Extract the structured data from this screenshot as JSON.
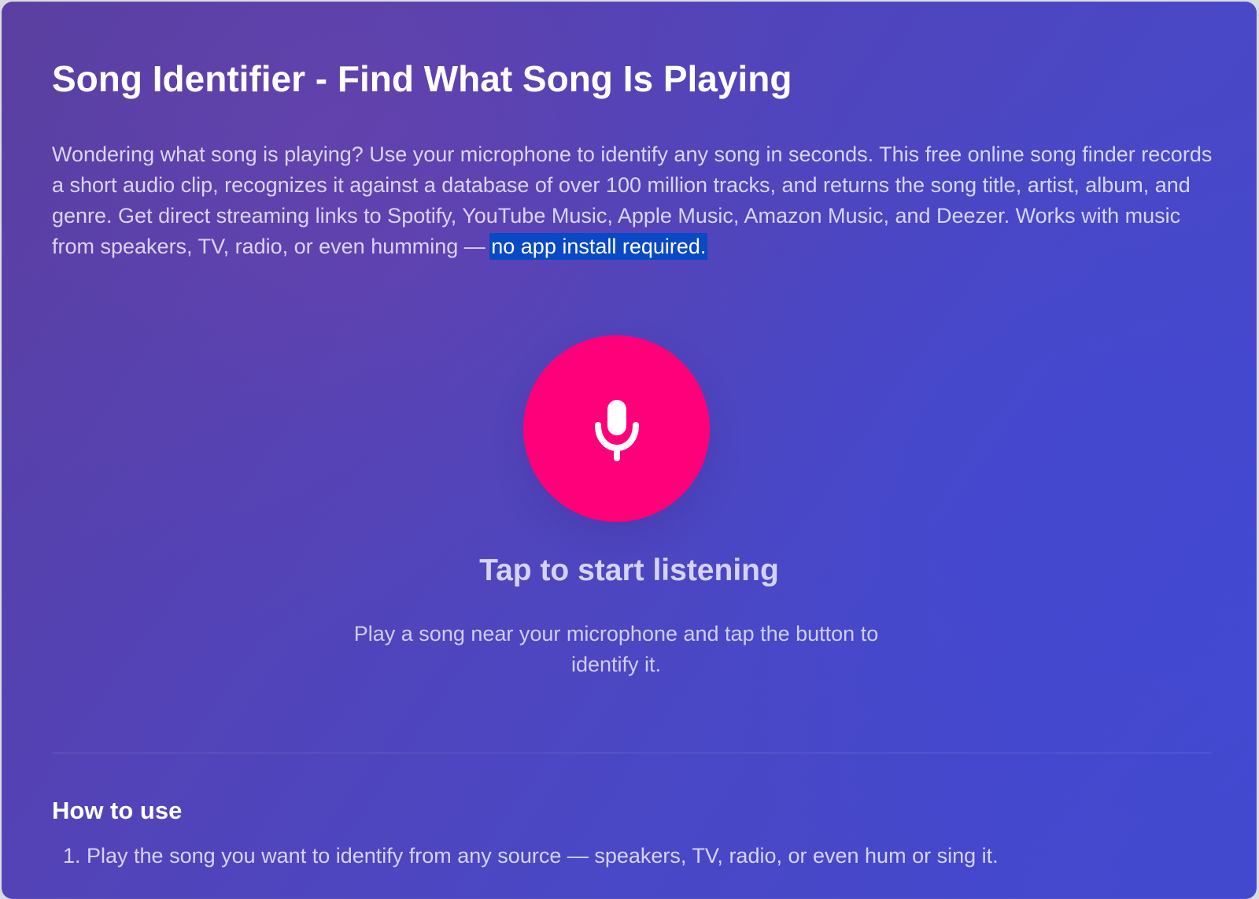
{
  "page": {
    "title": "Song Identifier - Find What Song Is Playing",
    "intro_prefix": "Wondering what song is playing? Use your microphone to identify any song in seconds. This free online song finder records a short audio clip, recognizes it against a database of over 100 million tracks, and returns the song title, artist, album, and genre. Get direct streaming links to Spotify, YouTube Music, Apple Music, Amazon Music, and Deezer. Works with music from speakers, TV, radio, or even humming — ",
    "intro_highlight": "no app install required."
  },
  "listener": {
    "icon": "microphone-icon",
    "button_color": "#ff007a",
    "status": "Tap to start listening",
    "hint": "Play a song near your microphone and tap the button to identify it."
  },
  "how_to_use": {
    "title": "How to use",
    "steps": [
      {
        "text": "1. Play the song you want to identify from any source — speakers, TV, radio, or even hum or sing it."
      }
    ]
  },
  "colors": {
    "background_start": "#5a3f9f",
    "background_end": "#4249cf",
    "selection_highlight": "#0949c6"
  }
}
